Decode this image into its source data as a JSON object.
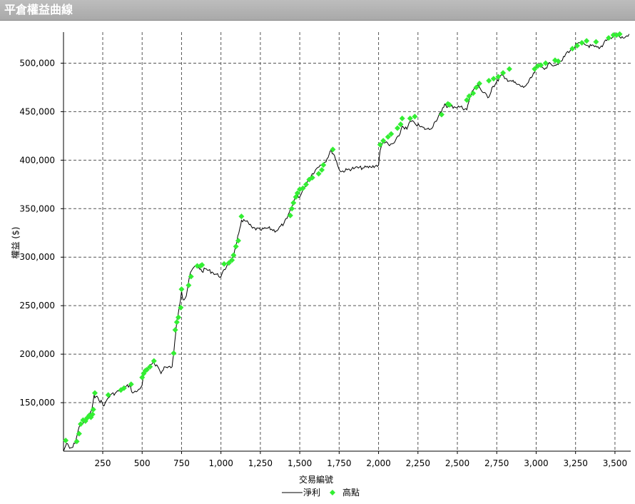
{
  "window_title": "平倉權益曲線",
  "chart_data": {
    "type": "line",
    "title": "",
    "xlabel": "交易編號",
    "ylabel": "權益 ($)",
    "xlim": [
      1,
      3600
    ],
    "ylim": [
      100000,
      532000
    ],
    "x_ticks": [
      250,
      500,
      750,
      1000,
      1250,
      1500,
      1750,
      2000,
      2250,
      2500,
      2750,
      3000,
      3250,
      3500
    ],
    "x_tick_labels": [
      "250",
      "500",
      "750",
      "1,000",
      "1,250",
      "1,500",
      "1,750",
      "2,000",
      "2,250",
      "2,500",
      "2,750",
      "3,000",
      "3,250",
      "3,500"
    ],
    "y_ticks": [
      150000,
      200000,
      250000,
      300000,
      350000,
      400000,
      450000,
      500000
    ],
    "y_tick_labels": [
      "150,000",
      "200,000",
      "250,000",
      "300,000",
      "350,000",
      "400,000",
      "450,000",
      "500,000"
    ],
    "grid": true,
    "legend_placement": "bottom-center",
    "series": [
      {
        "name": "淨利",
        "kind": "line",
        "color": "#000000",
        "x": [
          1,
          20,
          40,
          60,
          80,
          100,
          130,
          160,
          180,
          195,
          200,
          220,
          260,
          280,
          300,
          330,
          350,
          380,
          420,
          440,
          470,
          500,
          510,
          540,
          570,
          600,
          620,
          640,
          660,
          690,
          700,
          720,
          735,
          750,
          760,
          780,
          800,
          820,
          850,
          880,
          900,
          950,
          1000,
          1040,
          1080,
          1100,
          1120,
          1130,
          1160,
          1200,
          1250,
          1300,
          1350,
          1400,
          1420,
          1450,
          1480,
          1500,
          1530,
          1560,
          1600,
          1630,
          1660,
          1700,
          1720,
          1740,
          1760,
          1800,
          1850,
          1900,
          1950,
          2000,
          2010,
          2030,
          2070,
          2100,
          2130,
          2150,
          2180,
          2200,
          2230,
          2260,
          2300,
          2330,
          2360,
          2400,
          2420,
          2440,
          2480,
          2520,
          2560,
          2580,
          2600,
          2630,
          2660,
          2700,
          2720,
          2740,
          2780,
          2800,
          2840,
          2880,
          2920,
          2950,
          2990,
          3000,
          3030,
          3060,
          3090,
          3120,
          3160,
          3200,
          3230,
          3260,
          3290,
          3330,
          3370,
          3400,
          3420,
          3440,
          3470,
          3500,
          3530,
          3560,
          3590
        ],
        "y": [
          100000,
          108000,
          103000,
          104000,
          112000,
          125000,
          130000,
          135000,
          142000,
          158000,
          155000,
          155000,
          147000,
          154000,
          158000,
          160000,
          162000,
          165000,
          168000,
          160000,
          162000,
          168000,
          178000,
          186000,
          192000,
          187000,
          180000,
          187000,
          186000,
          187000,
          200000,
          235000,
          248000,
          265000,
          256000,
          260000,
          280000,
          288000,
          292000,
          285000,
          288000,
          284000,
          280000,
          292000,
          300000,
          315000,
          330000,
          338000,
          337000,
          330000,
          328000,
          330000,
          327000,
          335000,
          340000,
          352000,
          365000,
          362000,
          372000,
          382000,
          390000,
          395000,
          398000,
          410000,
          405000,
          395000,
          388000,
          390000,
          392000,
          392000,
          393000,
          395000,
          410000,
          420000,
          415000,
          418000,
          425000,
          435000,
          432000,
          440000,
          438000,
          435000,
          432000,
          432000,
          440000,
          450000,
          458000,
          455000,
          455000,
          455000,
          452000,
          465000,
          472000,
          478000,
          470000,
          465000,
          475000,
          478000,
          488000,
          484000,
          482000,
          478000,
          475000,
          480000,
          490000,
          497000,
          496000,
          495000,
          500000,
          498000,
          502000,
          512000,
          514000,
          520000,
          520000,
          518000,
          517000,
          515000,
          517000,
          524000,
          526000,
          529000,
          527000,
          526000,
          530000
        ]
      },
      {
        "name": "高點",
        "kind": "scatter",
        "color": "#33ee33",
        "x": [
          15,
          85,
          100,
          110,
          125,
          140,
          150,
          165,
          175,
          185,
          190,
          200,
          285,
          365,
          385,
          430,
          500,
          510,
          520,
          530,
          550,
          575,
          700,
          710,
          720,
          730,
          745,
          750,
          795,
          810,
          850,
          870,
          880,
          1020,
          1050,
          1070,
          1080,
          1095,
          1110,
          1130,
          1440,
          1450,
          1460,
          1475,
          1485,
          1500,
          1520,
          1540,
          1560,
          1580,
          1620,
          1640,
          1650,
          1710,
          2010,
          2030,
          2060,
          2080,
          2120,
          2140,
          2150,
          2200,
          2230,
          2400,
          2440,
          2450,
          2560,
          2575,
          2600,
          2620,
          2640,
          2700,
          2730,
          2760,
          2790,
          2830,
          2990,
          3010,
          3030,
          3060,
          3120,
          3140,
          3230,
          3260,
          3290,
          3320,
          3380,
          3460,
          3490,
          3510,
          3530
        ],
        "y": [
          111000,
          110000,
          118000,
          128000,
          132000,
          131000,
          134000,
          137000,
          135000,
          138000,
          143000,
          160000,
          158000,
          163000,
          165000,
          169000,
          176000,
          180000,
          183000,
          184000,
          187000,
          193000,
          201000,
          225000,
          233000,
          238000,
          248000,
          267000,
          271000,
          280000,
          291000,
          291000,
          292000,
          293000,
          294000,
          297000,
          302000,
          311000,
          317000,
          342000,
          343000,
          350000,
          356000,
          362000,
          366000,
          370000,
          371000,
          375000,
          380000,
          382000,
          386000,
          390000,
          395000,
          411000,
          416000,
          420000,
          424000,
          427000,
          433000,
          437000,
          443000,
          443000,
          445000,
          447000,
          458000,
          457000,
          462000,
          466000,
          469000,
          475000,
          479000,
          482000,
          484000,
          486000,
          490000,
          494000,
          494000,
          497000,
          498000,
          500000,
          503000,
          502000,
          515000,
          518000,
          521000,
          523000,
          522000,
          526000,
          529000,
          529000,
          530000
        ]
      }
    ]
  }
}
